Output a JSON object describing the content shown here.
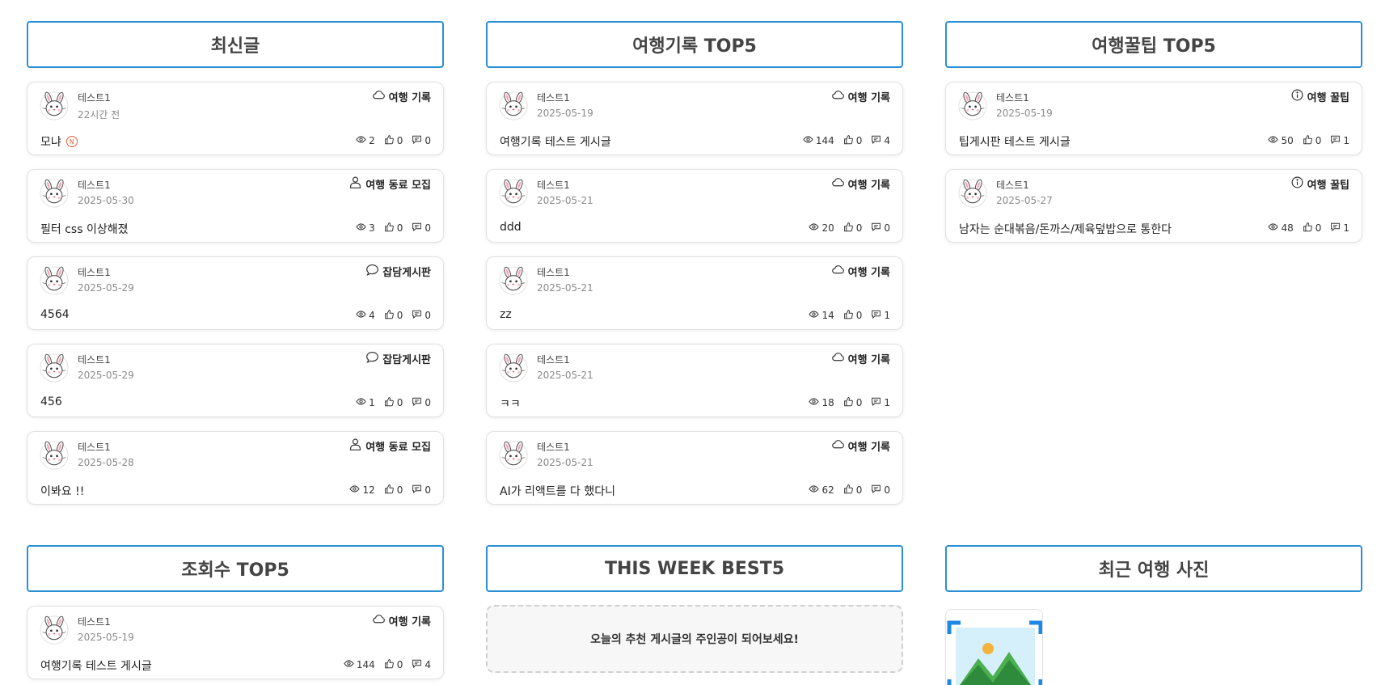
{
  "sections": {
    "latest": "최신글",
    "travel_top5": "여행기록 TOP5",
    "tips_top5": "여행꿀팁 TOP5",
    "views_top5": "조회수 TOP5",
    "week_best5": "THIS WEEK BEST5",
    "recent_photos": "최근 여행 사진"
  },
  "categories": {
    "travel": "여행 기록",
    "companion": "여행 동료 모집",
    "chat": "잡담게시판",
    "tips": "여행 꿀팁"
  },
  "icons": {
    "travel": "cloud-icon",
    "companion": "person-icon",
    "chat": "speech-bubble-icon",
    "tips": "info-icon",
    "views": "eye-icon",
    "likes": "thumbs-up-icon",
    "comments": "comment-icon",
    "new": "new-badge-icon"
  },
  "new_badge": "N",
  "latest_posts": [
    {
      "author": "테스트1",
      "date": "22시간 전",
      "category": "여행 기록",
      "title": "모냐",
      "is_new": true,
      "views": "2",
      "likes": "0",
      "comments": "0"
    },
    {
      "author": "테스트1",
      "date": "2025-05-30",
      "category": "여행 동료 모집",
      "title": "필터 css 이상해졌",
      "views": "3",
      "likes": "0",
      "comments": "0"
    },
    {
      "author": "테스트1",
      "date": "2025-05-29",
      "category": "잡담게시판",
      "title": "4564",
      "views": "4",
      "likes": "0",
      "comments": "0"
    },
    {
      "author": "테스트1",
      "date": "2025-05-29",
      "category": "잡담게시판",
      "title": "456",
      "views": "1",
      "likes": "0",
      "comments": "0"
    },
    {
      "author": "테스트1",
      "date": "2025-05-28",
      "category": "여행 동료 모집",
      "title": "이봐요 !!",
      "views": "12",
      "likes": "0",
      "comments": "0"
    }
  ],
  "travel_posts": [
    {
      "author": "테스트1",
      "date": "2025-05-19",
      "category": "여행 기록",
      "title": "여행기록 테스트 게시글",
      "views": "144",
      "likes": "0",
      "comments": "4"
    },
    {
      "author": "테스트1",
      "date": "2025-05-21",
      "category": "여행 기록",
      "title": "ddd",
      "views": "20",
      "likes": "0",
      "comments": "0"
    },
    {
      "author": "테스트1",
      "date": "2025-05-21",
      "category": "여행 기록",
      "title": "zz",
      "views": "14",
      "likes": "0",
      "comments": "1"
    },
    {
      "author": "테스트1",
      "date": "2025-05-21",
      "category": "여행 기록",
      "title": "ㅋㅋ",
      "views": "18",
      "likes": "0",
      "comments": "1"
    },
    {
      "author": "테스트1",
      "date": "2025-05-21",
      "category": "여행 기록",
      "title": "AI가 리액트를 다 했다니",
      "views": "62",
      "likes": "0",
      "comments": "0"
    }
  ],
  "tips_posts": [
    {
      "author": "테스트1",
      "date": "2025-05-19",
      "category": "여행 꿀팁",
      "title": "팁게시판 테스트 게시글",
      "views": "50",
      "likes": "0",
      "comments": "1"
    },
    {
      "author": "테스트1",
      "date": "2025-05-27",
      "category": "여행 꿀팁",
      "title": "남자는 순대볶음/돈까스/제육덮밥으로 통한다",
      "views": "48",
      "likes": "0",
      "comments": "1"
    }
  ],
  "views_posts": [
    {
      "author": "테스트1",
      "date": "2025-05-19",
      "category": "여행 기록",
      "title": "여행기록 테스트 게시글",
      "views": "144",
      "likes": "0",
      "comments": "4"
    }
  ],
  "week_best_empty": "오늘의 추천 게시글의 주인공이 되어보세요!"
}
